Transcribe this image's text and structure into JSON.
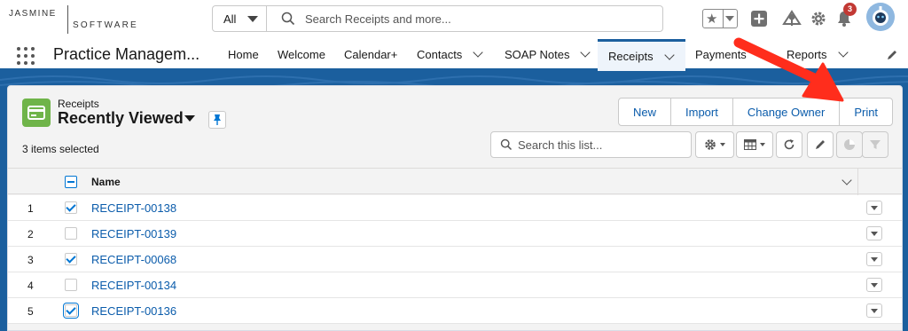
{
  "brand": {
    "logo_line1": "JASMINE",
    "logo_line2": "SOFTWARE"
  },
  "global_search": {
    "scope": "All",
    "placeholder": "Search Receipts and more..."
  },
  "notifications": {
    "count": "3"
  },
  "nav": {
    "app_name": "Practice Managem...",
    "items": [
      {
        "label": "Home",
        "has_menu": false
      },
      {
        "label": "Welcome",
        "has_menu": false
      },
      {
        "label": "Calendar+",
        "has_menu": false
      },
      {
        "label": "Contacts",
        "has_menu": true
      },
      {
        "label": "SOAP Notes",
        "has_menu": true
      },
      {
        "label": "Receipts",
        "has_menu": true,
        "active": true
      },
      {
        "label": "Payments",
        "has_menu": true
      },
      {
        "label": "Reports",
        "has_menu": true
      }
    ]
  },
  "list_view": {
    "object_label": "Receipts",
    "title": "Recently Viewed",
    "items_selected": "3 items selected",
    "actions": {
      "new": "New",
      "import": "Import",
      "change_owner": "Change Owner",
      "print": "Print"
    },
    "search_placeholder": "Search this list...",
    "column_header": "Name",
    "rows": [
      {
        "num": "1",
        "name": "RECEIPT-00138",
        "checked": true
      },
      {
        "num": "2",
        "name": "RECEIPT-00139",
        "checked": false
      },
      {
        "num": "3",
        "name": "RECEIPT-00068",
        "checked": true
      },
      {
        "num": "4",
        "name": "RECEIPT-00134",
        "checked": false
      },
      {
        "num": "5",
        "name": "RECEIPT-00136",
        "checked": true,
        "focused": true
      }
    ]
  },
  "icons": {
    "favorites": "star-icon",
    "global_actions": "plus-icon",
    "trailhead": "trailhead-icon",
    "setup": "gear-icon",
    "notifications": "bell-icon",
    "list_settings": "gear-icon",
    "display_as": "table-icon",
    "refresh": "refresh-icon",
    "inline_edit": "pencil-icon",
    "charts": "pie-chart-icon",
    "filters": "filter-icon"
  },
  "colors": {
    "brand_blue": "#1b5f9e",
    "link": "#0b5cab",
    "object_icon": "#6fb449",
    "badge": "#c23934",
    "annotation": "#ff2d1c"
  }
}
